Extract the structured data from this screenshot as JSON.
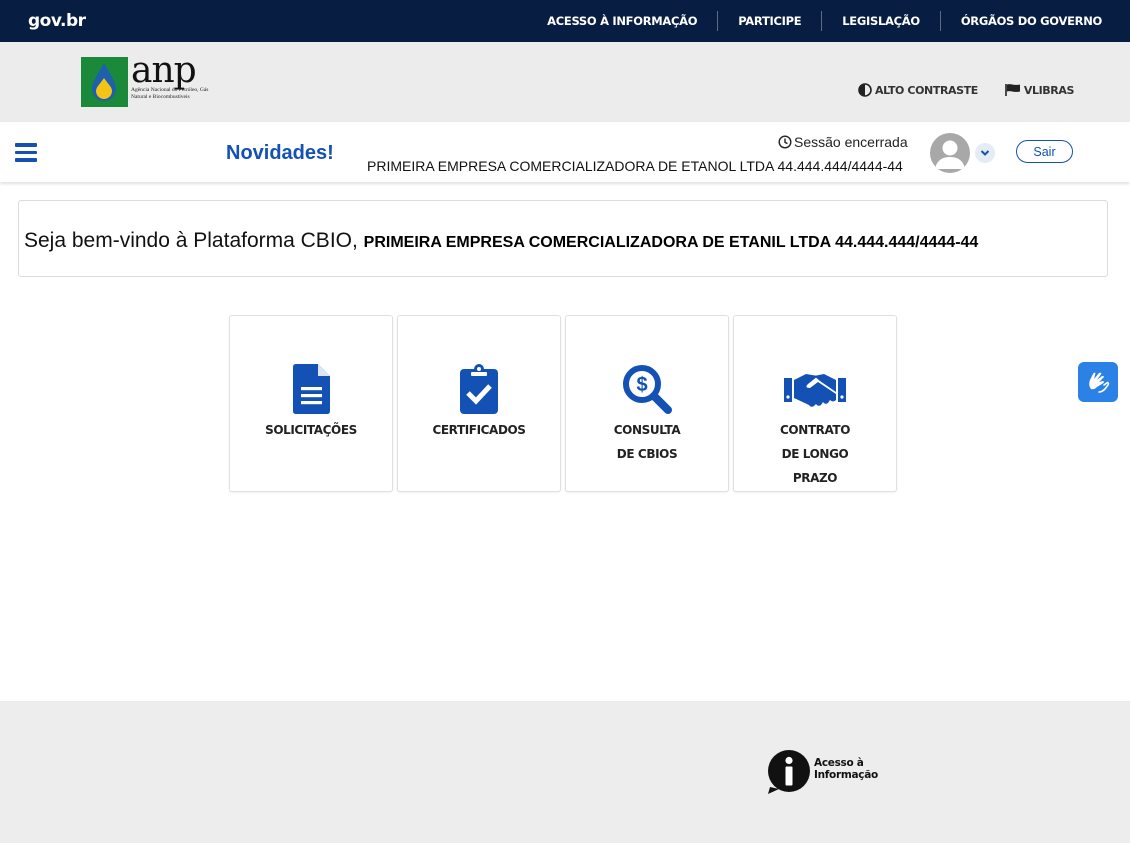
{
  "govbar": {
    "logo": "gov.br",
    "links": [
      "ACESSO À INFORMAÇÃO",
      "PARTICIPE",
      "LEGISLAÇÃO",
      "ÓRGÃOS DO GOVERNO"
    ]
  },
  "header": {
    "logo": {
      "wordmark": "anp",
      "subtitle": "Agência Nacional do Petróleo, Gás Natural e Biocombustíveis"
    },
    "tools": {
      "contrast": "ALTO CONTRASTE",
      "vlibras": "VLIBRAS"
    }
  },
  "nav": {
    "menu_icon": "hamburger-icon",
    "novidades": "Novidades!",
    "session_status": "Sessão encerrada",
    "company": "PRIMEIRA EMPRESA COMERCIALIZADORA DE ETANOL LTDA 44.444.444/4444-44",
    "logout": "Sair"
  },
  "welcome": {
    "greeting": "Seja bem-vindo à Plataforma CBIO,",
    "company": "PRIMEIRA EMPRESA COMERCIALIZADORA DE ETANIL LTDA 44.444.444/4444-44"
  },
  "cards": [
    {
      "label": "SOLICITAÇÕES",
      "icon": "document-icon"
    },
    {
      "label": "CERTIFICADOS",
      "icon": "clipboard-check-icon"
    },
    {
      "label": "CONSULTA\nDE CBIOS",
      "icon": "search-dollar-icon"
    },
    {
      "label": "CONTRATO\nDE LONGO\nPRAZO",
      "icon": "handshake-icon"
    }
  ],
  "footer": {
    "access_info": "Acesso à\nInformação"
  },
  "colors": {
    "gov_blue": "#071d41",
    "primary": "#1351b4",
    "vlibras": "#2c81e6"
  }
}
